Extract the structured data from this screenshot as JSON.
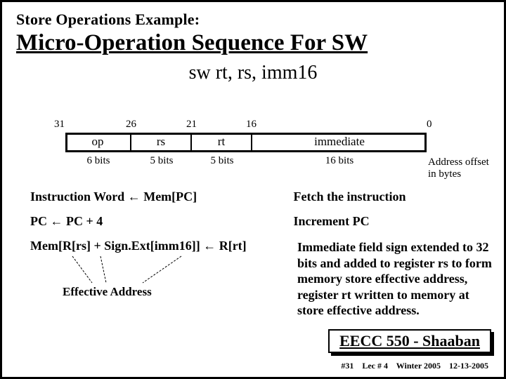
{
  "titles": {
    "pre": "Store Operations Example:",
    "main": "Micro-Operation Sequence For  SW",
    "syntax": "sw rt, rs, imm16"
  },
  "bits": {
    "p31": "31",
    "p26": "26",
    "p21": "21",
    "p16": "16",
    "p0": "0"
  },
  "fields": {
    "op": "op",
    "rs": "rs",
    "rt": "rt",
    "imm": "immediate"
  },
  "field_bits": {
    "op": "6 bits",
    "rs": "5 bits",
    "rt": "5 bits",
    "imm": "16 bits"
  },
  "note": {
    "l1": "Address offset",
    "l2": "in bytes"
  },
  "ops": {
    "a_left_1": "Instruction Word ",
    "a_left_arrow": "←",
    "a_left_2": "     Mem[PC]",
    "a_right": "Fetch the instruction",
    "b_left_1": "PC ",
    "b_left_arrow": "←",
    "b_left_2": "   PC + 4",
    "b_right": "Increment PC",
    "c_left_1": "Mem[R[rs] + Sign.Ext[imm16]]  ",
    "c_left_arrow": "←",
    "c_left_2": "  R[rt]"
  },
  "exdesc": "Immediate field sign extended to 32 bits and added to register  rs  to form memory store effective address, register  rt  written to memory at store effective address.",
  "ea_label": "Effective Address",
  "course": "EECC 550 - Shaaban",
  "footer": {
    "slide_no": "#31",
    "lec": "Lec # 4",
    "term": "Winter 2005",
    "date": "12-13-2005"
  }
}
